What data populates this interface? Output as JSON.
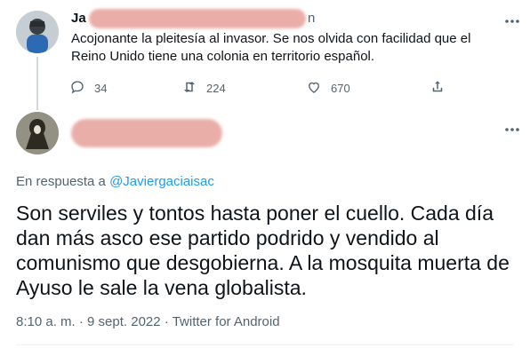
{
  "parent": {
    "author_partial": "Ja",
    "author_handle_end": "n",
    "text": "Acojonante la pleitesía al invasor. Se nos olvida con facilidad que el Reino Unido tiene una colonia en territorio español.",
    "replies": "34",
    "retweets": "224",
    "likes": "670"
  },
  "reply": {
    "reply_to_prefix": "En respuesta a ",
    "reply_to_handle": "@Javiergaciaisac",
    "text": "Son serviles y tontos hasta poner el cuello. Cada día dan más asco ese partido podrido y vendido al comunismo que desgobierna. A la mosquita muerta de Ayuso le sale la vena globalista.",
    "time": "8:10 a. m.",
    "sep": " · ",
    "date": "9 sept. 2022",
    "source": "Twitter for Android"
  },
  "icons": {
    "more": "more-icon",
    "reply": "reply-icon",
    "retweet": "retweet-icon",
    "like": "like-icon",
    "share": "share-icon"
  },
  "colors": {
    "link": "#1d9bf0",
    "muted": "#536471",
    "text": "#0f1419"
  }
}
